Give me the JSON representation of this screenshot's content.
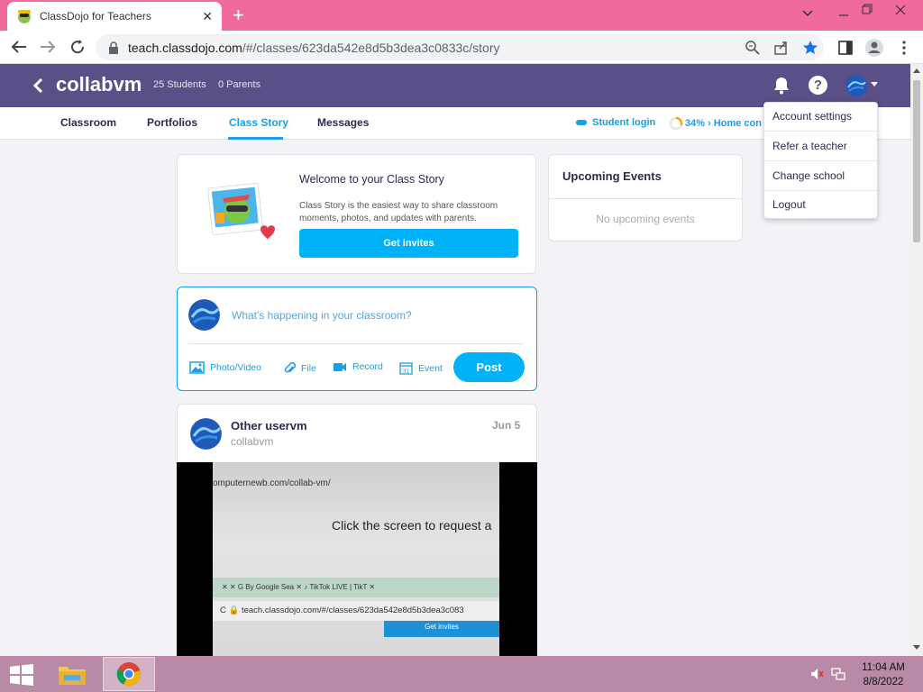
{
  "browser": {
    "tab_title": "ClassDojo for Teachers",
    "tab_close": "✕",
    "new_tab": "+",
    "url_host": "teach.classdojo.com",
    "url_path": "/#/classes/623da542e8d5b3dea3c0833c/story"
  },
  "header": {
    "class_name": "collabvm",
    "students": "25 Students",
    "parents": "0 Parents",
    "help": "?"
  },
  "subnav": {
    "items": [
      "Classroom",
      "Portfolios",
      "Class Story",
      "Messages"
    ],
    "active": "Class Story",
    "student_login": "Student login",
    "progress_text": "34% › Home con"
  },
  "welcome": {
    "title": "Welcome to your Class Story",
    "description": "Class Story is the easiest way to share classroom moments, photos, and updates with parents.",
    "button": "Get invites"
  },
  "composer": {
    "placeholder": "What's happening in your classroom?",
    "actions": [
      "Photo/Video",
      "File",
      "Record",
      "Event"
    ],
    "event_day": "31",
    "post": "Post"
  },
  "story": {
    "author": "Other uservm",
    "class": "collabvm",
    "date": "Jun 5",
    "media_url": "omputernewb.com/collab-vm/",
    "media_heading": "Click the screen to request a",
    "media_tabs": "✕   ✕    G   By  Google Sea   ✕     ♪  TikTok LIVE | TikT   ✕",
    "media_url2": "C    🔒  teach.classdojo.com/#/classes/623da542e8d5b3dea3c083",
    "media_button": "Get invites"
  },
  "events": {
    "title": "Upcoming Events",
    "empty": "No upcoming events"
  },
  "dropdown": {
    "items": [
      "Account settings",
      "Refer a teacher",
      "Change school",
      "Logout"
    ]
  },
  "taskbar": {
    "time": "11:04 AM",
    "date": "8/8/2022"
  },
  "colors": {
    "header": "#5a4f86",
    "accent": "#00b2f7",
    "tabbar": "#f06b9c",
    "taskbar": "#b88aa6"
  }
}
